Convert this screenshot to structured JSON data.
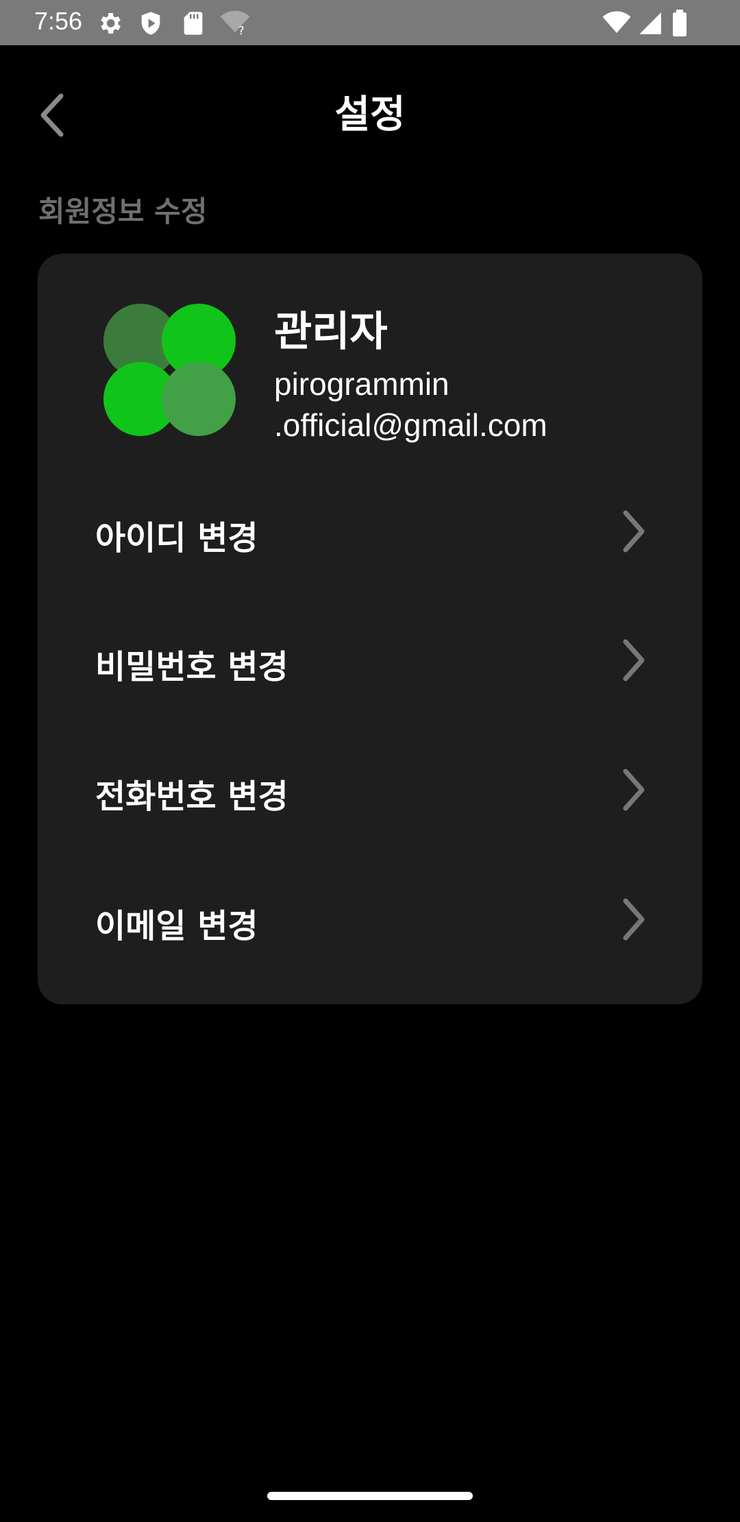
{
  "status_bar": {
    "time": "7:56",
    "icons_left": [
      "settings-icon",
      "shield-play-icon",
      "sd-card-icon",
      "wifi-question-icon"
    ],
    "icons_right": [
      "wifi-icon",
      "signal-icon",
      "battery-icon"
    ]
  },
  "header": {
    "title": "설정"
  },
  "section": {
    "title": "회원정보 수정"
  },
  "profile": {
    "name": "관리자",
    "email": "pirogrammin\n.official@gmail.com"
  },
  "menu": {
    "items": [
      {
        "label": "아이디 변경"
      },
      {
        "label": "비밀번호 변경"
      },
      {
        "label": "전화번호 변경"
      },
      {
        "label": "이메일 변경"
      }
    ]
  },
  "colors": {
    "background": "#000000",
    "card": "#1e1e1e",
    "section_title": "#6f6f6f",
    "accent_green": "#11c41a",
    "chevron": "#777777"
  }
}
